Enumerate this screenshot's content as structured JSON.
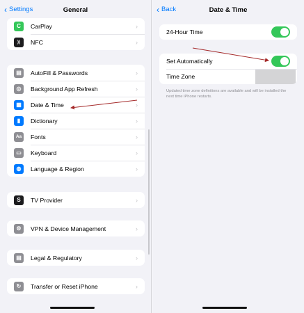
{
  "left": {
    "back_label": "Settings",
    "title": "General",
    "group1": [
      {
        "label": "CarPlay",
        "icon": "carplay-icon",
        "color": "#34c759",
        "glyph": "C"
      },
      {
        "label": "NFC",
        "icon": "nfc-icon",
        "color": "#1c1c1e",
        "glyph": "))"
      }
    ],
    "group2": [
      {
        "label": "AutoFill & Passwords",
        "icon": "autofill-icon",
        "color": "#8e8e93",
        "glyph": "▤"
      },
      {
        "label": "Background App Refresh",
        "icon": "refresh-icon",
        "color": "#8e8e93",
        "glyph": "◎"
      },
      {
        "label": "Date & Time",
        "icon": "calendar-icon",
        "color": "#007aff",
        "glyph": "▦"
      },
      {
        "label": "Dictionary",
        "icon": "dictionary-icon",
        "color": "#007aff",
        "glyph": "▮"
      },
      {
        "label": "Fonts",
        "icon": "fonts-icon",
        "color": "#8e8e93",
        "glyph": "Aa"
      },
      {
        "label": "Keyboard",
        "icon": "keyboard-icon",
        "color": "#8e8e93",
        "glyph": "▭"
      },
      {
        "label": "Language & Region",
        "icon": "globe-icon",
        "color": "#007aff",
        "glyph": "◍"
      }
    ],
    "group3": [
      {
        "label": "TV Provider",
        "icon": "tv-provider-icon",
        "color": "#1c1c1e",
        "glyph": "S"
      }
    ],
    "group4": [
      {
        "label": "VPN & Device Management",
        "icon": "vpn-gear-icon",
        "color": "#8e8e93",
        "glyph": "⚙"
      }
    ],
    "group5": [
      {
        "label": "Legal & Regulatory",
        "icon": "legal-icon",
        "color": "#8e8e93",
        "glyph": "▤"
      }
    ],
    "group6": [
      {
        "label": "Transfer or Reset iPhone",
        "icon": "reset-icon",
        "color": "#8e8e93",
        "glyph": "↻"
      }
    ]
  },
  "right": {
    "back_label": "Back",
    "title": "Date & Time",
    "twenty_four_hour_label": "24-Hour Time",
    "twenty_four_hour_on": true,
    "set_auto_label": "Set Automatically",
    "set_auto_on": true,
    "time_zone_label": "Time Zone",
    "footer": "Updated time zone definitions are available and will be installed the next time iPhone restarts."
  },
  "annotation_color": "#a52a2a"
}
